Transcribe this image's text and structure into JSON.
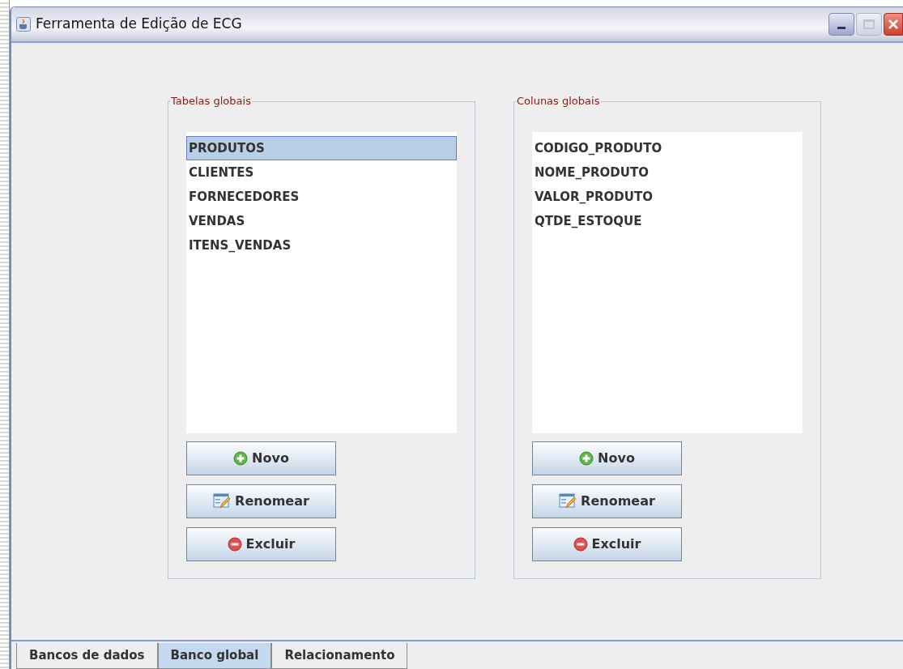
{
  "window": {
    "title": "Ferramenta de Edição de ECG"
  },
  "panels": [
    {
      "title": "Tabelas globais",
      "items": [
        {
          "label": "PRODUTOS",
          "selected": true
        },
        {
          "label": "CLIENTES",
          "selected": false
        },
        {
          "label": "FORNECEDORES",
          "selected": false
        },
        {
          "label": "VENDAS",
          "selected": false
        },
        {
          "label": "ITENS_VENDAS",
          "selected": false
        }
      ],
      "buttons": [
        {
          "label": "Novo",
          "kind": "add"
        },
        {
          "label": "Renomear",
          "kind": "rename"
        },
        {
          "label": "Excluir",
          "kind": "delete"
        }
      ]
    },
    {
      "title": "Colunas globais",
      "items": [
        {
          "label": "CODIGO_PRODUTO",
          "selected": false
        },
        {
          "label": "NOME_PRODUTO",
          "selected": false
        },
        {
          "label": "VALOR_PRODUTO",
          "selected": false
        },
        {
          "label": "QTDE_ESTOQUE",
          "selected": false
        }
      ],
      "buttons": [
        {
          "label": "Novo",
          "kind": "add"
        },
        {
          "label": "Renomear",
          "kind": "rename"
        },
        {
          "label": "Excluir",
          "kind": "delete"
        }
      ]
    }
  ],
  "tabs": [
    {
      "label": "Bancos de dados",
      "selected": false
    },
    {
      "label": "Banco global",
      "selected": true
    },
    {
      "label": "Relacionamento",
      "selected": false
    }
  ]
}
